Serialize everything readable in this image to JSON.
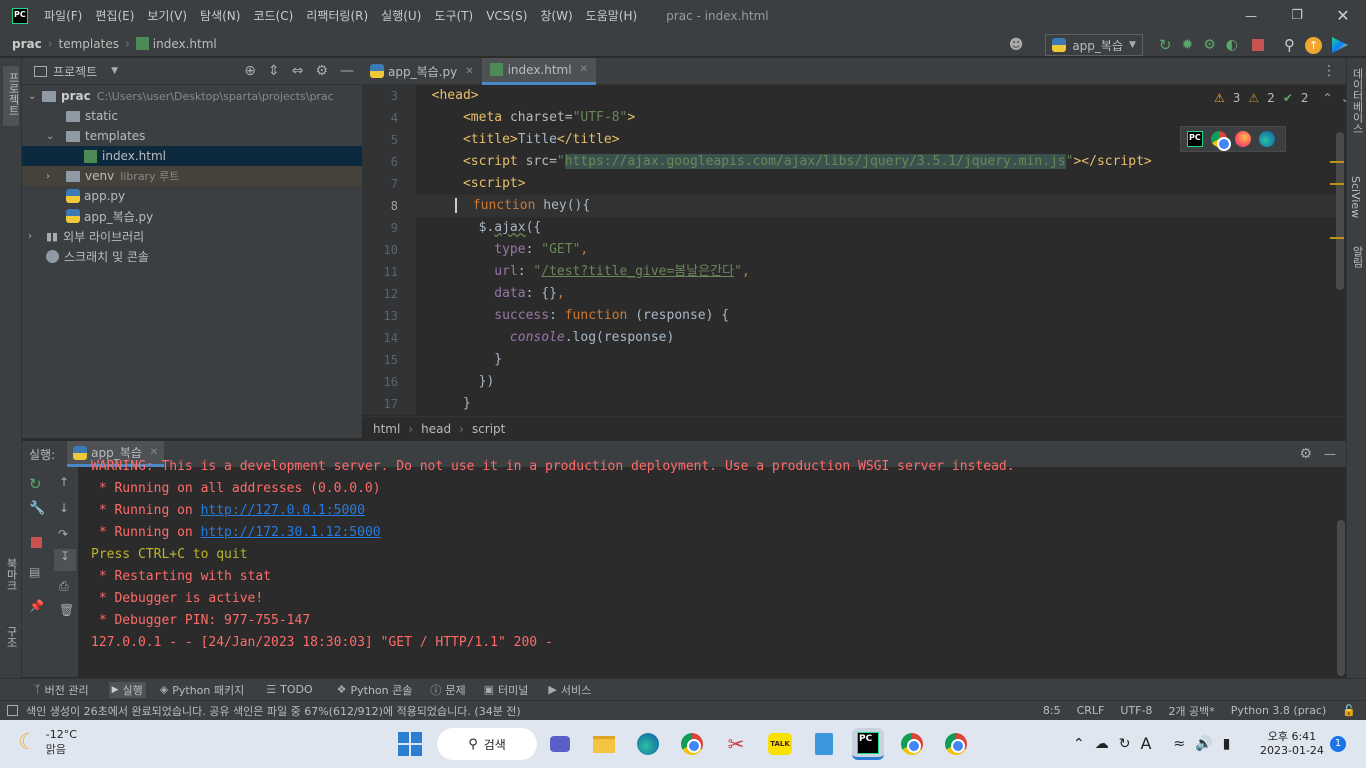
{
  "titlebar": {
    "menus": [
      "파일(F)",
      "편집(E)",
      "보기(V)",
      "탐색(N)",
      "코드(C)",
      "리팩터링(R)",
      "실행(U)",
      "도구(T)",
      "VCS(S)",
      "창(W)",
      "도움말(H)"
    ],
    "window_title": "prac - index.html"
  },
  "navbar": {
    "crumbs": [
      "prac",
      "templates",
      "index.html"
    ],
    "run_config": "app_복습"
  },
  "left_strip": {
    "project": "프로젝트",
    "bookmarks": "북마크",
    "structure": "구조"
  },
  "right_strip": {
    "database": "데이터베이스",
    "sciview": "SciView",
    "notifications": "알림"
  },
  "project_panel": {
    "title": "프로젝트",
    "items": [
      {
        "label": "prac",
        "path": "C:\\Users\\user\\Desktop\\sparta\\projects\\prac"
      },
      {
        "label": "static"
      },
      {
        "label": "templates"
      },
      {
        "label": "index.html"
      },
      {
        "label": "venv",
        "note": "library 루트"
      },
      {
        "label": "app.py"
      },
      {
        "label": "app_복습.py"
      },
      {
        "label": "외부 라이브러리"
      },
      {
        "label": "스크래치 및 콘솔"
      }
    ]
  },
  "editor": {
    "tabs": [
      "app_복습.py",
      "index.html"
    ],
    "inspections": {
      "errors": "3",
      "warnings": "2",
      "ok": "2"
    },
    "line_numbers": [
      "3",
      "4",
      "5",
      "6",
      "7",
      "8",
      "9",
      "10",
      "11",
      "12",
      "13",
      "14",
      "15",
      "16",
      "17"
    ],
    "current_line": "8",
    "breadcrumb": [
      "html",
      "head",
      "script"
    ]
  },
  "run_panel": {
    "label": "실행:",
    "tab": "app_복습",
    "lines": [
      "WARNING: This is a development server. Do not use it in a production deployment. Use a production WSGI server instead.",
      " * Running on all addresses (0.0.0.0)",
      " * Running on ",
      "http://127.0.0.1:5000",
      " * Running on ",
      "http://172.30.1.12:5000",
      "Press CTRL+C to quit",
      " * Restarting with stat",
      " * Debugger is active!",
      " * Debugger PIN: 977-755-147",
      "127.0.0.1 - - [24/Jan/2023 18:30:03] \"GET / HTTP/1.1\" 200 -"
    ]
  },
  "tool_windows": [
    "버전 관리",
    "실행",
    "Python 패키지",
    "TODO",
    "Python 콘솔",
    "문제",
    "터미널",
    "서비스"
  ],
  "status": {
    "message": "색인 생성이 26초에서 완료되었습니다. 공유 색인은 파일 중 67%(612/912)에 적용되었습니다. (34분 전)",
    "position": "8:5",
    "line_sep": "CRLF",
    "encoding": "UTF-8",
    "indent": "2개 공백*",
    "interpreter": "Python 3.8 (prac)"
  },
  "taskbar": {
    "weather_temp": "-12°C",
    "weather_desc": "맑음",
    "search": "검색",
    "time": "오후 6:41",
    "date": "2023-01-24",
    "notif_count": "1",
    "ime": "A"
  }
}
